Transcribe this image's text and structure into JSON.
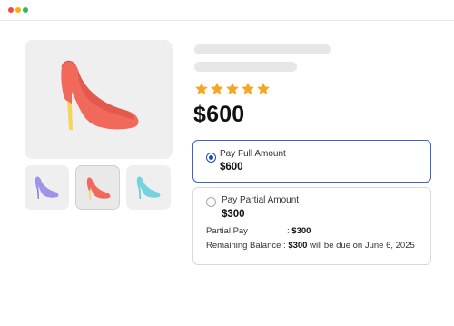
{
  "window": {
    "controls": [
      {
        "name": "close",
        "color": "#ee4b43"
      },
      {
        "name": "minimize",
        "color": "#f4b400"
      },
      {
        "name": "maximize",
        "color": "#2fb950"
      }
    ]
  },
  "product": {
    "main_image_icon": "high-heel-shoe-icon",
    "main_image_colors": {
      "body": "#f0695a",
      "shade": "#d94d42",
      "heel": "#f6d25e"
    },
    "thumbnails": [
      {
        "icon": "high-heel-shoe-icon",
        "color": "#9d93ea",
        "heel": "#8577dc",
        "selected": false
      },
      {
        "icon": "high-heel-shoe-icon",
        "color": "#f0695a",
        "heel": "#f6d25e",
        "selected": true
      },
      {
        "icon": "high-heel-shoe-icon",
        "color": "#74d3dd",
        "heel": "#5cc2cf",
        "selected": false
      }
    ],
    "rating": {
      "value": 5,
      "max": 5,
      "star_color": "#f5a623",
      "icon": "star-icon"
    },
    "price": "$600"
  },
  "payment_options": {
    "full": {
      "label": "Pay Full Amount",
      "amount": "$600",
      "selected": true,
      "accent": "#1f48c4"
    },
    "partial": {
      "label": "Pay Partial Amount",
      "amount": "$300",
      "selected": false,
      "partial_pay_label": "Partial Pay",
      "partial_pay_sep": ": ",
      "partial_pay_value": "$300",
      "remaining_label": "Remaining Balance",
      "remaining_sep": " : ",
      "remaining_value": "$300",
      "remaining_note": " will be due on June 6, 2025"
    }
  }
}
